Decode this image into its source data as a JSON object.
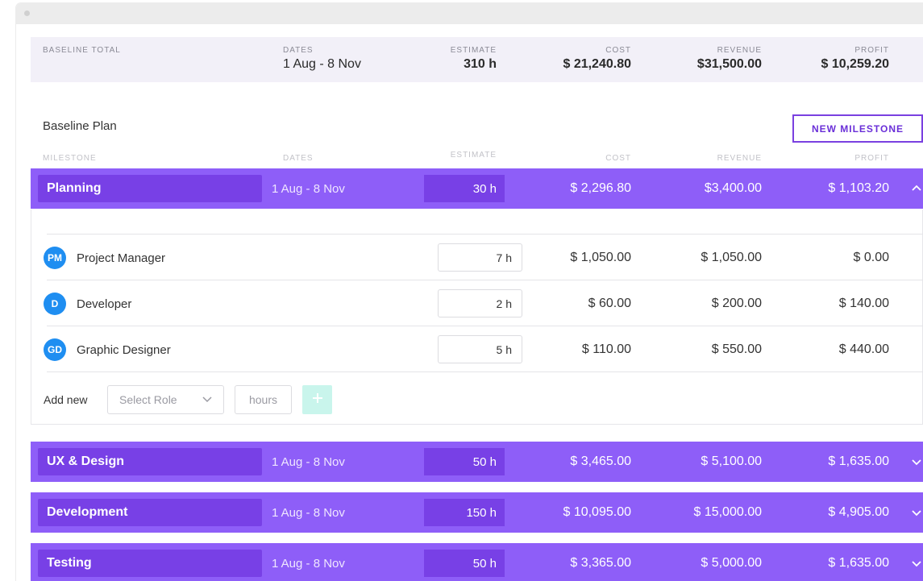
{
  "summary": {
    "label": "BASELINE TOTAL",
    "dates_label": "DATES",
    "dates": "1 Aug - 8 Nov",
    "estimate_label": "ESTIMATE",
    "estimate": "310 h",
    "cost_label": "COST",
    "cost": "$ 21,240.80",
    "revenue_label": "REVENUE",
    "revenue": "$31,500.00",
    "profit_label": "PROFIT",
    "profit": "$ 10,259.20"
  },
  "plan": {
    "title": "Baseline Plan",
    "new_milestone": "NEW MILESTONE",
    "headers": {
      "milestone": "MILESTONE",
      "dates": "DATES",
      "estimate": "ESTIMATE",
      "cost": "COST",
      "revenue": "REVENUE",
      "profit": "PROFIT"
    }
  },
  "milestones": [
    {
      "name": "Planning",
      "dates": "1 Aug - 8 Nov",
      "estimate": "30 h",
      "cost": "$ 2,296.80",
      "revenue": "$3,400.00",
      "profit": "$ 1,103.20",
      "expanded": true
    },
    {
      "name": "UX & Design",
      "dates": "1 Aug - 8 Nov",
      "estimate": "50 h",
      "cost": "$ 3,465.00",
      "revenue": "$ 5,100.00",
      "profit": "$ 1,635.00",
      "expanded": false
    },
    {
      "name": "Development",
      "dates": "1 Aug - 8 Nov",
      "estimate": "150 h",
      "cost": "$ 10,095.00",
      "revenue": "$ 15,000.00",
      "profit": "$ 4,905.00",
      "expanded": false
    },
    {
      "name": "Testing",
      "dates": "1 Aug - 8 Nov",
      "estimate": "50 h",
      "cost": "$ 3,365.00",
      "revenue": "$ 5,000.00",
      "profit": "$ 1,635.00",
      "expanded": false
    }
  ],
  "roles": [
    {
      "initials": "PM",
      "name": "Project Manager",
      "hours": "7 h",
      "cost": "$ 1,050.00",
      "revenue": "$ 1,050.00",
      "profit": "$ 0.00"
    },
    {
      "initials": "D",
      "name": "Developer",
      "hours": "2 h",
      "cost": "$ 60.00",
      "revenue": "$ 200.00",
      "profit": "$ 140.00"
    },
    {
      "initials": "GD",
      "name": "Graphic Designer",
      "hours": "5 h",
      "cost": "$ 110.00",
      "revenue": "$ 550.00",
      "profit": "$ 440.00"
    }
  ],
  "add_new": {
    "label": "Add new",
    "role_placeholder": "Select Role",
    "hours_placeholder": "hours"
  },
  "colors": {
    "milestone_bg": "#8e5ef8",
    "milestone_cell": "#7840e6",
    "accent": "#6a2fd8",
    "avatar": "#1f8ef1",
    "add_button": "#c9f5ec"
  },
  "icons": {
    "expanded": "chevron-up-icon",
    "collapsed": "chevron-down-icon",
    "add": "plus-icon",
    "select": "chevron-down-icon"
  }
}
